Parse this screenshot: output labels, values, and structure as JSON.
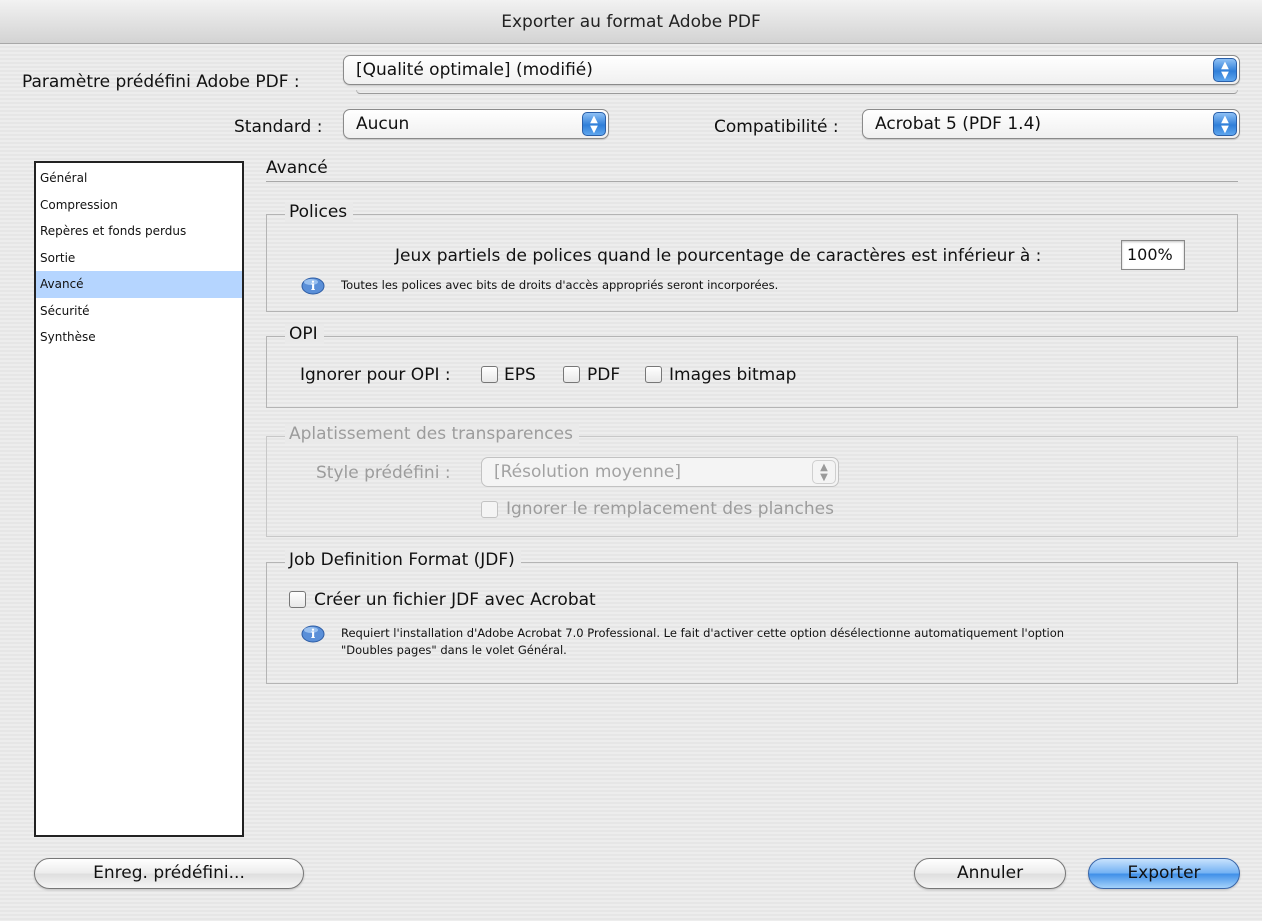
{
  "window": {
    "title": "Exporter au format Adobe PDF"
  },
  "preset": {
    "label": "Paramètre prédéfini Adobe PDF :",
    "value": "[Qualité optimale] (modifié)"
  },
  "standard": {
    "label": "Standard :",
    "value": "Aucun"
  },
  "compatibility": {
    "label": "Compatibilité :",
    "value": "Acrobat 5 (PDF 1.4)"
  },
  "sidebar": {
    "items": [
      {
        "label": "Général"
      },
      {
        "label": "Compression"
      },
      {
        "label": "Repères et fonds perdus"
      },
      {
        "label": "Sortie"
      },
      {
        "label": "Avancé",
        "selected": true
      },
      {
        "label": "Sécurité"
      },
      {
        "label": "Synthèse"
      }
    ]
  },
  "section": {
    "title": "Avancé"
  },
  "fonts": {
    "title": "Polices",
    "subset_label": "Jeux partiels de polices quand le pourcentage de caractères est inférieur à :",
    "subset_value": "100%",
    "info": "Toutes les polices avec bits de droits d'accès appropriés seront incorporées."
  },
  "opi": {
    "title": "OPI",
    "label": "Ignorer pour OPI :",
    "eps": "EPS",
    "pdf": "PDF",
    "bitmap": "Images bitmap"
  },
  "flattener": {
    "title": "Aplatissement des transparences",
    "style_label": "Style prédéfini :",
    "style_value": "[Résolution moyenne]",
    "ignore_overrides": "Ignorer le remplacement des planches"
  },
  "jdf": {
    "title": "Job Definition Format (JDF)",
    "create_label": "Créer un fichier JDF avec Acrobat",
    "info_line1": "Requiert l'installation d'Adobe Acrobat 7.0 Professional. Le fait d'activer cette option désélectionne automatiquement l'option",
    "info_line2": "\"Doubles pages\" dans le volet Général."
  },
  "buttons": {
    "save_preset": "Enreg. prédéfini...",
    "cancel": "Annuler",
    "export": "Exporter"
  },
  "colors": {
    "selection": "#b5d5ff",
    "accent": "#3e8ee8"
  }
}
